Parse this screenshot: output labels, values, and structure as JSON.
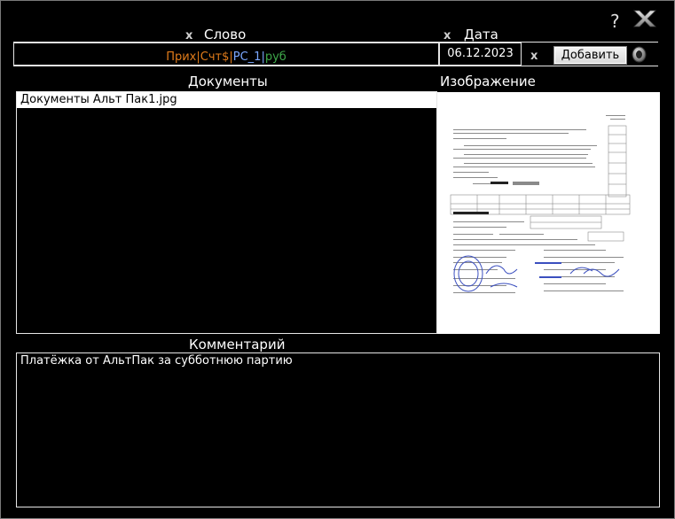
{
  "header": {
    "help_glyph": "?",
    "close_icon": "close-icon",
    "clear_glyph": "x"
  },
  "filters": {
    "word_label": "Слово",
    "date_label": "Дата",
    "word_tokens": [
      {
        "text": "Прих",
        "color": "#e07b1a"
      },
      {
        "text": "|",
        "color": "#e07b1a"
      },
      {
        "text": "Счт$",
        "color": "#e07b1a"
      },
      {
        "text": "|",
        "color": "#e07b1a"
      },
      {
        "text": "PC_1",
        "color": "#7aa7ff"
      },
      {
        "text": "|",
        "color": "#7aa7ff"
      },
      {
        "text": "руб",
        "color": "#3ea84a"
      }
    ],
    "date_value": "06.12.2023",
    "add_button": "Добавить"
  },
  "documents": {
    "title": "Документы",
    "items": [
      "Документы Альт Пак1.jpg"
    ]
  },
  "image_panel": {
    "title": "Изображение"
  },
  "comment": {
    "title": "Комментарий",
    "text": "Платёжка от АльтПак за субботнюю партию"
  },
  "colors": {
    "background": "#000000",
    "border": "#e6e6e6",
    "stamp": "#3b4fbf"
  }
}
